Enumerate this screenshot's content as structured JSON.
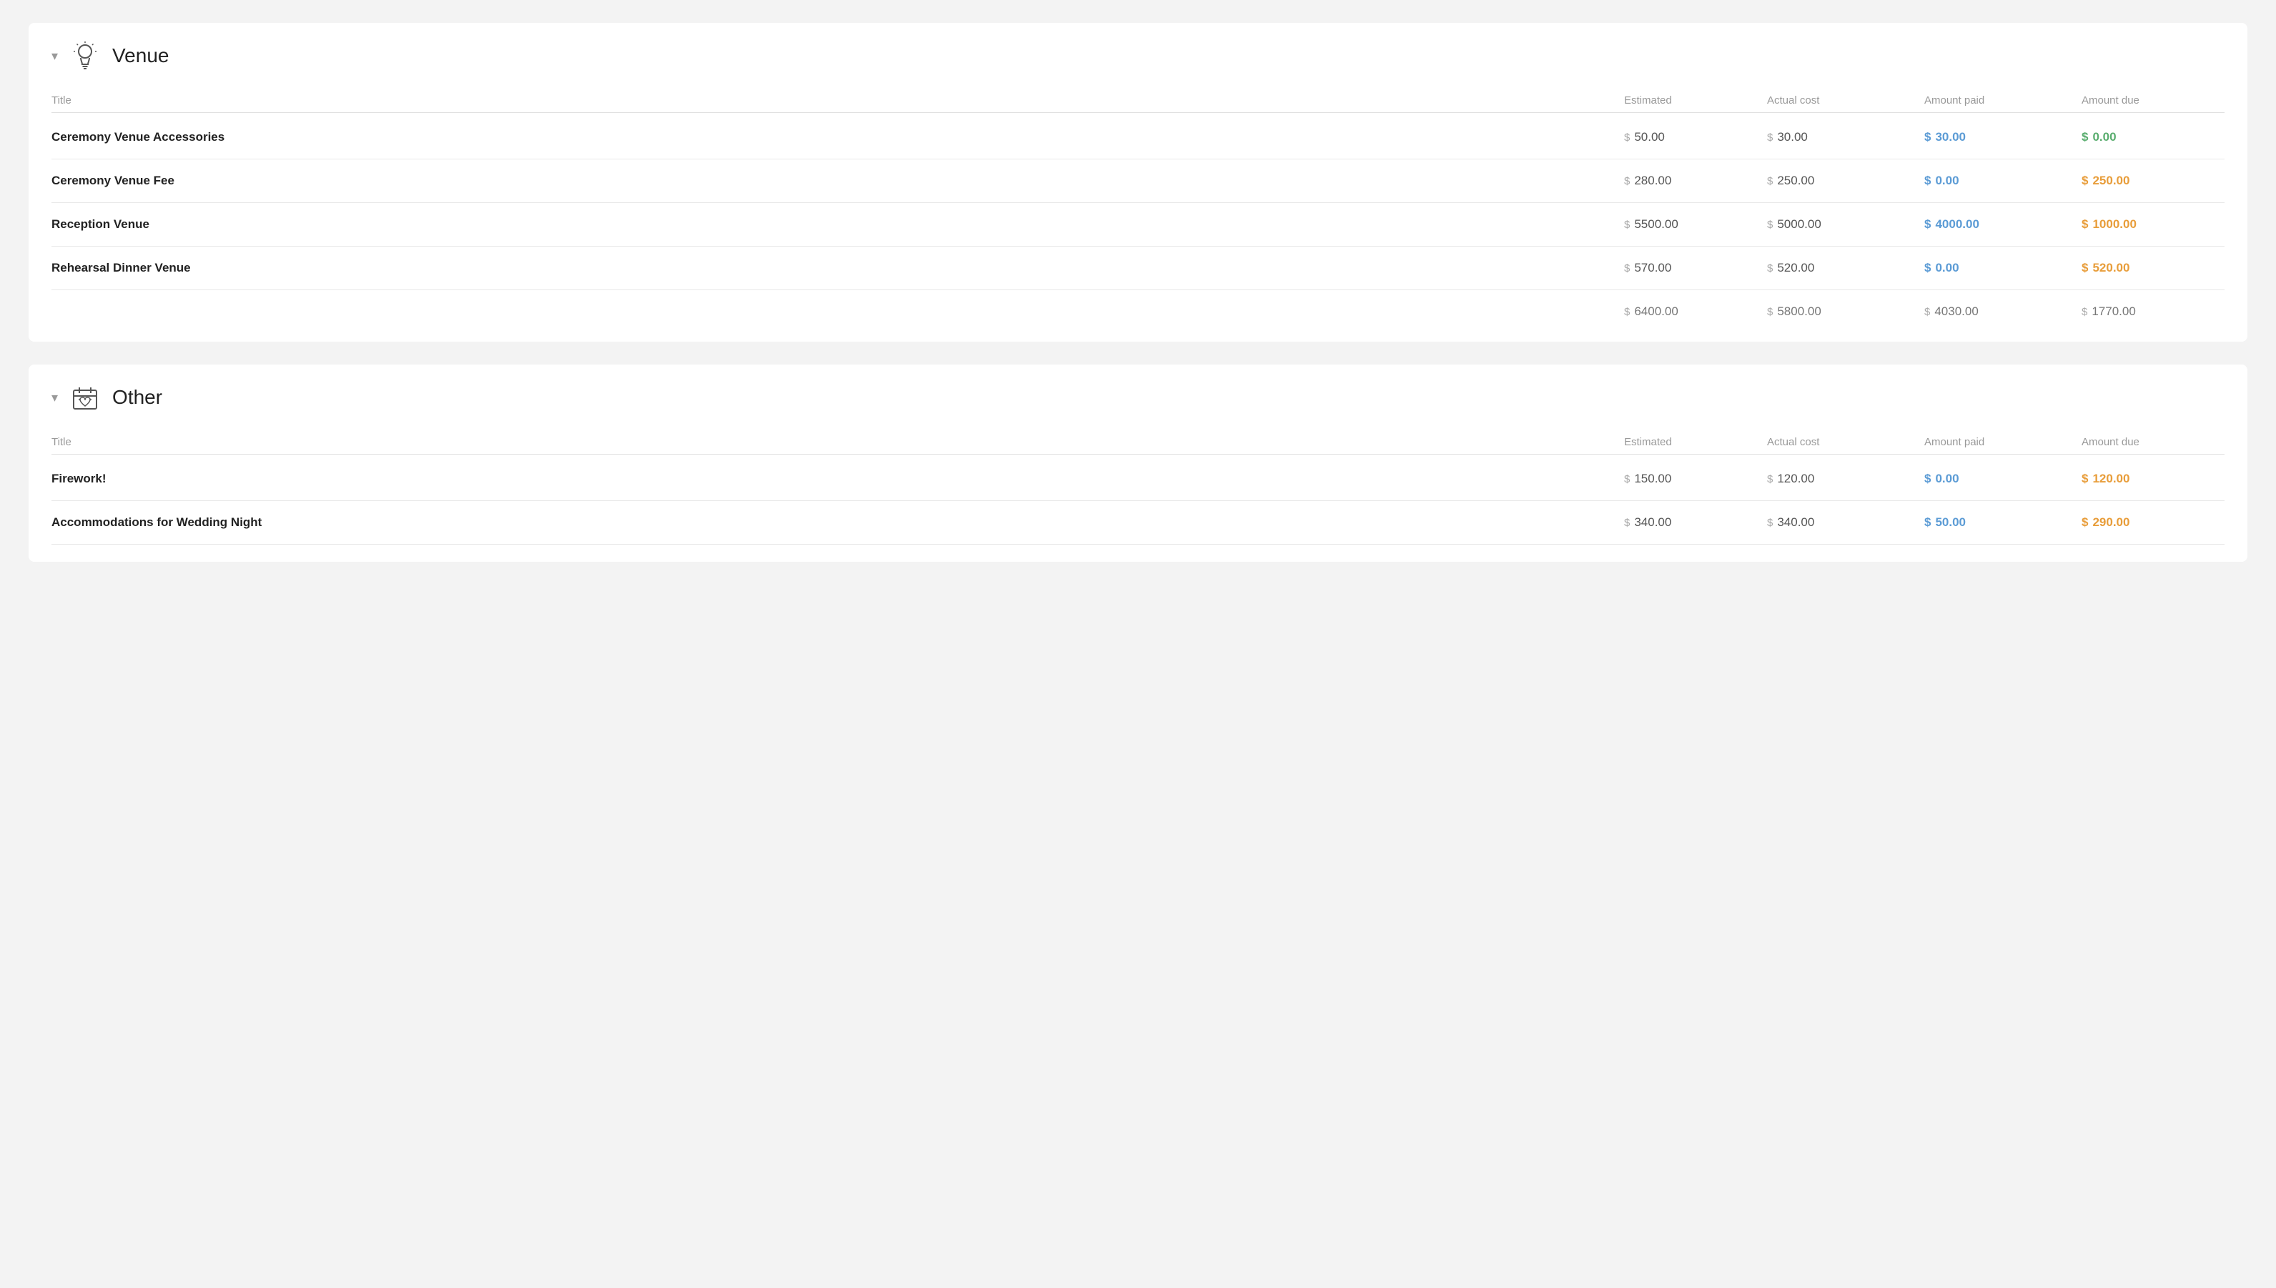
{
  "venue_section": {
    "title": "Venue",
    "chevron": "▾",
    "header": {
      "col1": "Title",
      "col2": "Estimated",
      "col3": "Actual cost",
      "col4": "Amount paid",
      "col5": "Amount due"
    },
    "rows": [
      {
        "title": "Ceremony Venue Accessories",
        "estimated": "50.00",
        "actual": "30.00",
        "paid": "30.00",
        "due": "0.00",
        "due_zero": true
      },
      {
        "title": "Ceremony Venue Fee",
        "estimated": "280.00",
        "actual": "250.00",
        "paid": "0.00",
        "due": "250.00",
        "due_zero": false
      },
      {
        "title": "Reception Venue",
        "estimated": "5500.00",
        "actual": "5000.00",
        "paid": "4000.00",
        "due": "1000.00",
        "due_zero": false
      },
      {
        "title": "Rehearsal Dinner Venue",
        "estimated": "570.00",
        "actual": "520.00",
        "paid": "0.00",
        "due": "520.00",
        "due_zero": false
      }
    ],
    "totals": {
      "estimated": "6400.00",
      "actual": "5800.00",
      "paid": "4030.00",
      "due": "1770.00"
    }
  },
  "other_section": {
    "title": "Other",
    "chevron": "▾",
    "header": {
      "col1": "Title",
      "col2": "Estimated",
      "col3": "Actual cost",
      "col4": "Amount paid",
      "col5": "Amount due"
    },
    "rows": [
      {
        "title": "Firework!",
        "estimated": "150.00",
        "actual": "120.00",
        "paid": "0.00",
        "due": "120.00",
        "due_zero": false
      },
      {
        "title": "Accommodations for Wedding Night",
        "estimated": "340.00",
        "actual": "340.00",
        "paid": "50.00",
        "due": "290.00",
        "due_zero": false
      }
    ]
  },
  "icons": {
    "venue_svg": "bulb",
    "other_svg": "heart-box"
  }
}
